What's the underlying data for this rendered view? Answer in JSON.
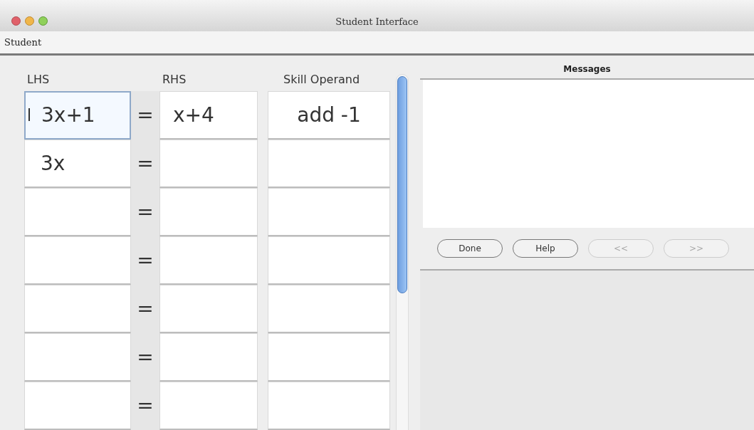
{
  "window": {
    "title": "Student Interface"
  },
  "menu": [
    "Student"
  ],
  "table": {
    "columns": [
      "LHS",
      "RHS",
      "Skill Operand"
    ],
    "rows": [
      {
        "lhs": "3x+1",
        "eq": "=",
        "rhs": "x+4",
        "operand": "add -1",
        "selected": true
      },
      {
        "lhs": "3x",
        "eq": "=",
        "rhs": "",
        "operand": "",
        "selected": false
      },
      {
        "lhs": "",
        "eq": "=",
        "rhs": "",
        "operand": "",
        "selected": false
      },
      {
        "lhs": "",
        "eq": "=",
        "rhs": "",
        "operand": "",
        "selected": false
      },
      {
        "lhs": "",
        "eq": "=",
        "rhs": "",
        "operand": "",
        "selected": false
      },
      {
        "lhs": "",
        "eq": "=",
        "rhs": "",
        "operand": "",
        "selected": false
      },
      {
        "lhs": "",
        "eq": "=",
        "rhs": "",
        "operand": "",
        "selected": false
      }
    ]
  },
  "messages": {
    "title": "Messages"
  },
  "buttons": [
    {
      "label": "Done",
      "disabled": false
    },
    {
      "label": "Help",
      "disabled": false
    },
    {
      "label": "<<",
      "disabled": true
    },
    {
      "label": ">>",
      "disabled": true
    }
  ]
}
